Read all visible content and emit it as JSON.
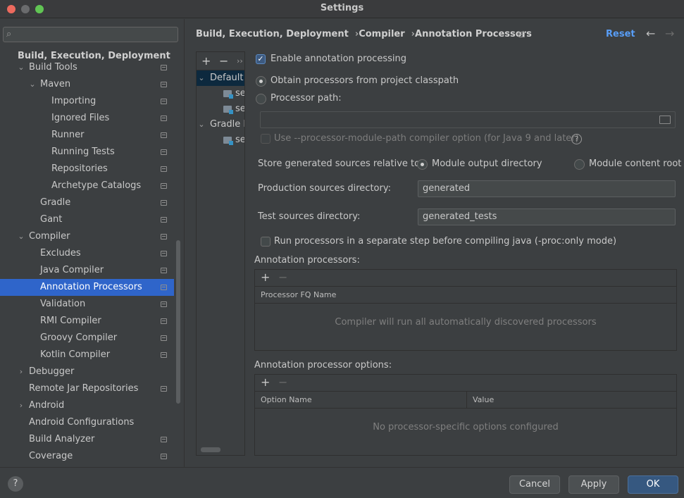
{
  "window": {
    "title": "Settings"
  },
  "search": {
    "placeholder": ""
  },
  "sidebar": {
    "section_title": "Build, Execution, Deployment",
    "items": [
      {
        "label": "Build Tools",
        "chevron": "⌄"
      },
      {
        "label": "Maven",
        "chevron": "⌄"
      },
      {
        "label": "Importing"
      },
      {
        "label": "Ignored Files"
      },
      {
        "label": "Runner"
      },
      {
        "label": "Running Tests"
      },
      {
        "label": "Repositories"
      },
      {
        "label": "Archetype Catalogs"
      },
      {
        "label": "Gradle"
      },
      {
        "label": "Gant"
      },
      {
        "label": "Compiler",
        "chevron": "⌄"
      },
      {
        "label": "Excludes"
      },
      {
        "label": "Java Compiler"
      },
      {
        "label": "Annotation Processors"
      },
      {
        "label": "Validation"
      },
      {
        "label": "RMI Compiler"
      },
      {
        "label": "Groovy Compiler"
      },
      {
        "label": "Kotlin Compiler"
      },
      {
        "label": "Debugger",
        "chevron": "›"
      },
      {
        "label": "Remote Jar Repositories"
      },
      {
        "label": "Android",
        "chevron": "›"
      },
      {
        "label": "Android Configurations"
      },
      {
        "label": "Build Analyzer"
      },
      {
        "label": "Coverage"
      }
    ]
  },
  "breadcrumb": {
    "part1": "Build, Execution, Deployment",
    "part2": "Compiler",
    "part3": "Annotation Processors",
    "sep": "›"
  },
  "header": {
    "reset": "Reset",
    "back": "←",
    "forward": "→"
  },
  "profiles": {
    "add": "+",
    "remove": "−",
    "more": "››",
    "rows": [
      {
        "label": "Default",
        "chevron": "⌄"
      },
      {
        "label": "se"
      },
      {
        "label": "se"
      },
      {
        "label": "Gradle I",
        "chevron": "⌄"
      },
      {
        "label": "se"
      }
    ]
  },
  "form": {
    "enable_label": "Enable annotation processing",
    "enable_check": "✓",
    "obtain_label": "Obtain processors from project classpath",
    "path_label": "Processor path:",
    "path_value": "",
    "module_path_label": "Use --processor-module-path compiler option (for Java 9 and later)",
    "help": "?",
    "store_label": "Store generated sources relative to:",
    "module_output": "Module output directory",
    "module_content": "Module content root",
    "production_label": "Production sources directory:",
    "production_value": "generated",
    "test_label": "Test sources directory:",
    "test_value": "generated_tests",
    "separate_step_label": "Run processors in a separate step before compiling java (-proc:only mode)"
  },
  "processors_table": {
    "title": "Annotation processors:",
    "add": "+",
    "remove": "−",
    "column": "Processor FQ Name",
    "empty": "Compiler will run all automatically discovered processors"
  },
  "options_table": {
    "title": "Annotation processor options:",
    "add": "+",
    "remove": "−",
    "col1": "Option Name",
    "col2": "Value",
    "empty": "No processor-specific options configured"
  },
  "footer": {
    "help": "?",
    "cancel": "Cancel",
    "apply": "Apply",
    "ok": "OK"
  },
  "colors": {
    "accent": "#2f65ca",
    "link": "#589df6",
    "ok_button": "#365880"
  }
}
